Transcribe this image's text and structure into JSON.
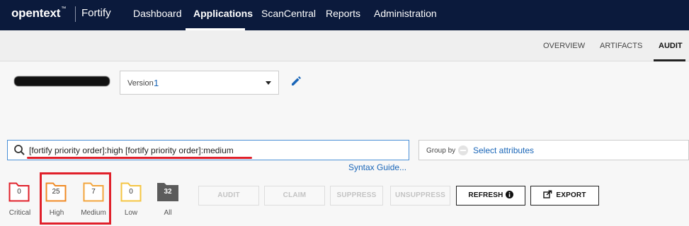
{
  "brand": {
    "name": "opentext",
    "tm": "™",
    "product": "Fortify"
  },
  "nav": [
    {
      "label": "Dashboard",
      "active": false
    },
    {
      "label": "Applications",
      "active": true
    },
    {
      "label": "ScanCentral",
      "active": false
    },
    {
      "label": "Reports",
      "active": false
    },
    {
      "label": "Administration",
      "active": false
    }
  ],
  "subtabs": [
    {
      "label": "OVERVIEW",
      "active": false
    },
    {
      "label": "ARTIFACTS",
      "active": false
    },
    {
      "label": "AUDIT",
      "active": true
    }
  ],
  "version": {
    "label": "Version",
    "value": "1"
  },
  "search": {
    "query": "[fortify priority order]:high [fortify priority order]:medium",
    "syntax_link": "Syntax Guide..."
  },
  "groupby": {
    "label": "Group by",
    "value": "Select attributes"
  },
  "priorities": [
    {
      "label": "Critical",
      "count": "0",
      "color": "#e0202a"
    },
    {
      "label": "High",
      "count": "25",
      "color": "#f08a24"
    },
    {
      "label": "Medium",
      "count": "7",
      "color": "#f3a53c"
    },
    {
      "label": "Low",
      "count": "0",
      "color": "#f5c542"
    },
    {
      "label": "All",
      "count": "32",
      "color": "#5b5b5b"
    }
  ],
  "actions": [
    {
      "label": "AUDIT",
      "enabled": false
    },
    {
      "label": "CLAIM",
      "enabled": false
    },
    {
      "label": "SUPPRESS",
      "enabled": false
    },
    {
      "label": "UNSUPPRESS",
      "enabled": false
    },
    {
      "label": "REFRESH",
      "enabled": true,
      "icon": "info-icon"
    },
    {
      "label": "EXPORT",
      "enabled": true,
      "icon": "export-icon"
    }
  ]
}
